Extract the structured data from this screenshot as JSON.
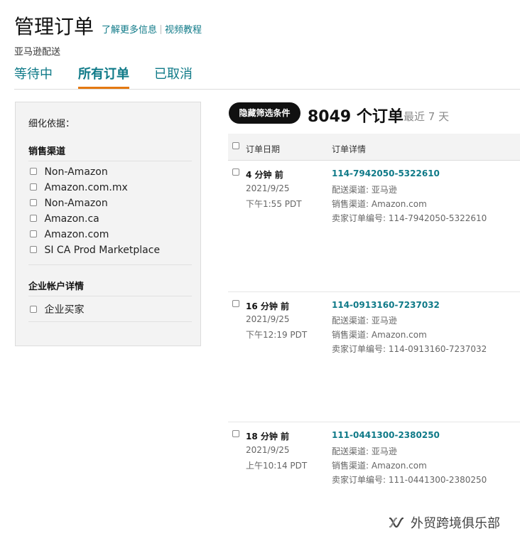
{
  "header": {
    "title": "管理订单",
    "learn_more": "了解更多信息",
    "video_tutorial": "视频教程",
    "subtitle": "亚马逊配送"
  },
  "tabs": [
    {
      "label": "等待中",
      "active": false
    },
    {
      "label": "所有订单",
      "active": true
    },
    {
      "label": "已取消",
      "active": false
    }
  ],
  "filters": {
    "refine_label": "细化依据：",
    "sections": [
      {
        "title": "销售渠道",
        "options": [
          "Non-Amazon",
          "Amazon.com.mx",
          "Non-Amazon",
          "Amazon.ca",
          "Amazon.com",
          "SI CA Prod Marketplace"
        ]
      },
      {
        "title": "企业帐户详情",
        "options": [
          "企业买家"
        ]
      }
    ]
  },
  "results": {
    "hide_filters_button": "隐藏筛选条件",
    "count_text": "8049 个订单",
    "range_text": "最近 7 天",
    "columns": [
      "订单日期",
      "订单详情"
    ]
  },
  "orders": [
    {
      "ago": "4 分钟 前",
      "date": "2021/9/25",
      "time": "下午1:55 PDT",
      "order_id": "114-7942050-5322610",
      "fulfillment": "配送渠道: 亚马逊",
      "channel": "销售渠道: Amazon.com",
      "seller_order": "卖家订单编号: 114-7942050-5322610"
    },
    {
      "ago": "16 分钟 前",
      "date": "2021/9/25",
      "time": "下午12:19 PDT",
      "order_id": "114-0913160-7237032",
      "fulfillment": "配送渠道: 亚马逊",
      "channel": "销售渠道: Amazon.com",
      "seller_order": "卖家订单编号: 114-0913160-7237032"
    },
    {
      "ago": "18 分钟 前",
      "date": "2021/9/25",
      "time": "上午10:14 PDT",
      "order_id": "111-0441300-2380250",
      "fulfillment": "配送渠道: 亚马逊",
      "channel": "销售渠道: Amazon.com",
      "seller_order": "卖家订单编号: 111-0441300-2380250"
    }
  ],
  "watermark": {
    "text": "外贸跨境俱乐部",
    "icon": "wechat-channel-icon"
  },
  "colors": {
    "link_teal": "#0f7a88",
    "tab_underline": "#e47911",
    "panel_bg": "#f3f3f3"
  }
}
